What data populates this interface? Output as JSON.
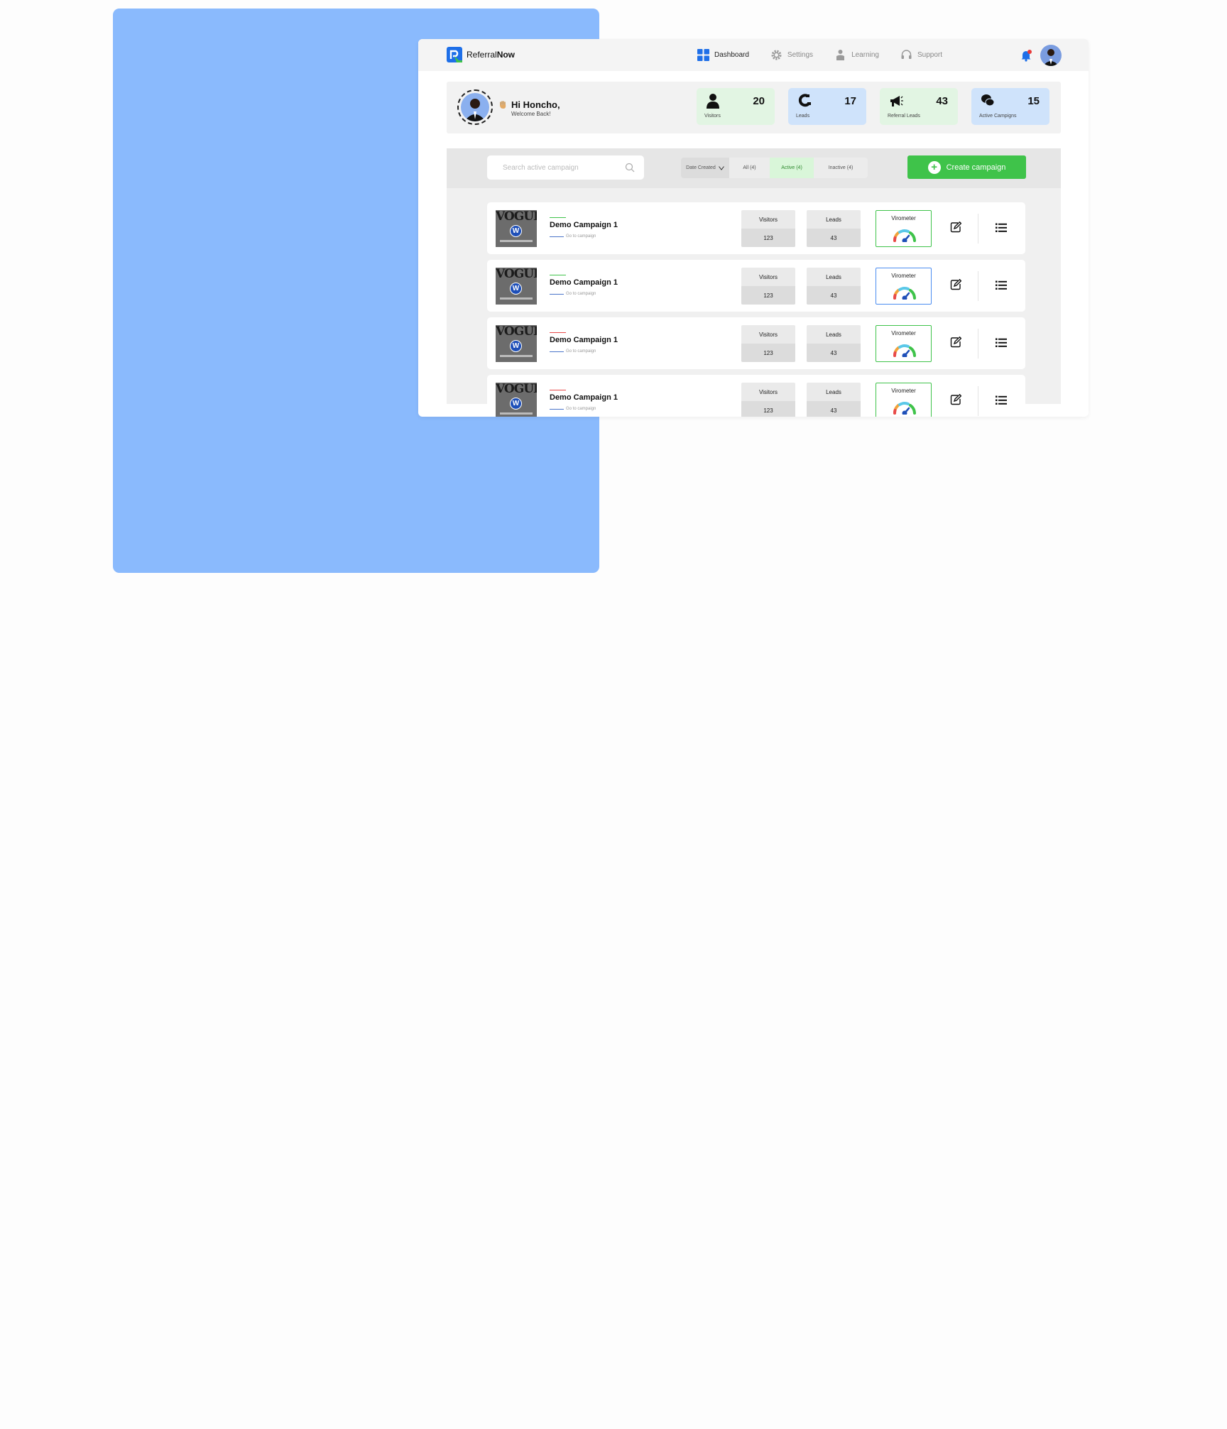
{
  "app": {
    "logo_regular": "Referral",
    "logo_bold": "Now"
  },
  "nav": [
    {
      "label": "Dashboard",
      "icon": "dashboard-icon",
      "active": true
    },
    {
      "label": "Settings",
      "icon": "gear-icon",
      "active": false
    },
    {
      "label": "Learning",
      "icon": "learning-icon",
      "active": false
    },
    {
      "label": "Support",
      "icon": "headset-icon",
      "active": false
    }
  ],
  "welcome": {
    "greeting": "Hi Honcho,",
    "subtitle": "Welcome Back!"
  },
  "stats": [
    {
      "label": "Visitors",
      "value": "20",
      "icon": "user-icon",
      "color": "#e2f5e3"
    },
    {
      "label": "Leads",
      "value": "17",
      "icon": "magnet-icon",
      "color": "#cfe3fb"
    },
    {
      "label": "Referral Leads",
      "value": "43",
      "icon": "megaphone-icon",
      "color": "#e2f5e3"
    },
    {
      "label": "Active Campigns",
      "value": "15",
      "icon": "chat-bubbles-icon",
      "color": "#cfe3fb"
    }
  ],
  "search": {
    "placeholder": "Search active campaign",
    "value": ""
  },
  "filters": {
    "sort_label": "Date Created",
    "all": "All (4)",
    "active": "Active (4)",
    "inactive": "Inactive (4)"
  },
  "create_button": "Create campaign",
  "metric_labels": {
    "visitors": "Visitors",
    "leads": "Leads",
    "virometer": "Virometer"
  },
  "campaigns": [
    {
      "name": "Demo Campaign 1",
      "link": "Go to campaign",
      "visitors": "123",
      "leads": "43",
      "status_color": "#3fc34a",
      "virometer_border": "#3fc34a"
    },
    {
      "name": "Demo Campaign 1",
      "link": "Go to campaign",
      "visitors": "123",
      "leads": "43",
      "status_color": "#3fc34a",
      "virometer_border": "#4a8cf0"
    },
    {
      "name": "Demo Campaign 1",
      "link": "Go to campaign",
      "visitors": "123",
      "leads": "43",
      "status_color": "#e84a4a",
      "virometer_border": "#3fc34a"
    },
    {
      "name": "Demo Campaign 1",
      "link": "Go to campaign",
      "visitors": "123",
      "leads": "43",
      "status_color": "#e84a4a",
      "virometer_border": "#3fc34a"
    }
  ],
  "thumbnail_text": "VOGUE",
  "colors": {
    "accent_green": "#3fc34a",
    "accent_blue": "#1e6fe8",
    "backdrop_blue": "#8abafd"
  }
}
